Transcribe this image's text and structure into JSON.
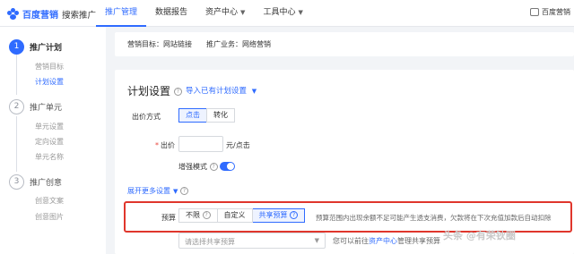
{
  "header": {
    "brand": "百度营销",
    "product": "搜索推广",
    "nav": [
      "推广管理",
      "数据报告",
      "资产中心",
      "工具中心"
    ],
    "user": "百度营销"
  },
  "steps": [
    {
      "num": "1",
      "title": "推广计划",
      "subs": [
        "营销目标",
        "计划设置"
      ]
    },
    {
      "num": "2",
      "title": "推广单元",
      "subs": [
        "单元设置",
        "定向设置",
        "单元名称"
      ]
    },
    {
      "num": "3",
      "title": "推广创意",
      "subs": [
        "创意文案",
        "创意图片"
      ]
    }
  ],
  "goal_bar": {
    "target_label": "营销目标：",
    "target_value": "网站链接",
    "business_label": "推广业务：",
    "business_value": "网络营销"
  },
  "plan": {
    "title": "计划设置",
    "import_link": "导入已有计划设置",
    "bid_mode_label": "出价方式",
    "bid_modes": [
      "点击",
      "转化"
    ],
    "price_label": "出价",
    "price_value": "",
    "price_unit": "元/点击",
    "enhanced_label": "增强模式",
    "expand_link": "展开更多设置",
    "budget_label": "预算",
    "budget_options": [
      "不限",
      "自定义",
      "共享预算"
    ],
    "budget_note": "预算范围内出现余额不足可能产生透支消费，欠款将在下次充值加款后自动扣除",
    "shared_placeholder": "请选择共享预算",
    "shared_hint_pre": "您可以前往",
    "shared_hint_link": "资产中心",
    "shared_hint_post": "管理共享预算"
  },
  "watermark": "头条 @有荣钬圈"
}
